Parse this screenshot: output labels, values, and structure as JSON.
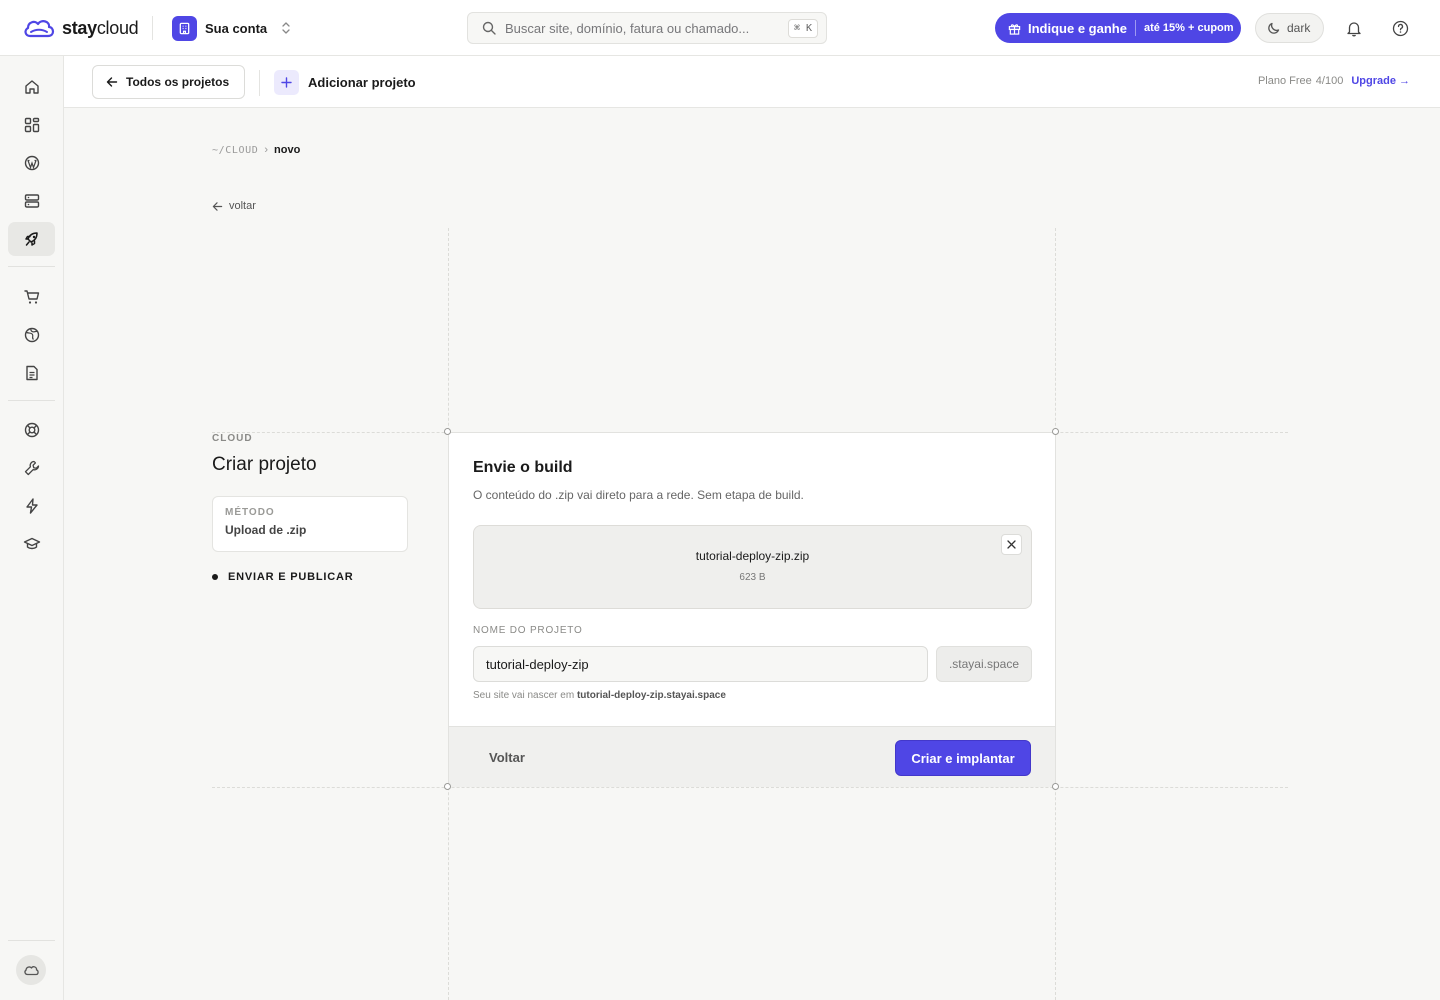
{
  "brand": {
    "bold": "stay",
    "light": "cloud"
  },
  "account": {
    "name": "Sua conta"
  },
  "search": {
    "placeholder": "Buscar site, domínio, fatura ou chamado...",
    "shortcut": "⌘ K"
  },
  "referral": {
    "label": "Indique e ganhe",
    "tag": "até 15% + cupom"
  },
  "theme": {
    "label": "dark"
  },
  "colors": {
    "accent": "#4f46e5",
    "background": "#f7f7f5",
    "surface": "#ffffff"
  },
  "sidebar": {
    "items": [
      {
        "icon": "home-icon"
      },
      {
        "icon": "grid-icon"
      },
      {
        "icon": "wordpress-icon"
      },
      {
        "icon": "server-icon"
      },
      {
        "icon": "rocket-icon",
        "active": true
      },
      {
        "icon": "cart-icon"
      },
      {
        "icon": "globe-icon"
      },
      {
        "icon": "document-icon"
      },
      {
        "icon": "lifebuoy-icon"
      },
      {
        "icon": "wrench-icon"
      },
      {
        "icon": "lightning-icon"
      },
      {
        "icon": "graduation-cap-icon"
      }
    ],
    "footer_icon": "cloud-icon"
  },
  "subheader": {
    "back_label": "Todos os projetos",
    "add_label": "Adicionar projeto",
    "plan": "Plano Free",
    "plan_usage": "4/100",
    "upgrade": "Upgrade →"
  },
  "breadcrumb": {
    "root": "~/CLOUD",
    "separator": "›",
    "current": "novo"
  },
  "back_link": "voltar",
  "wizard": {
    "eyebrow": "CLOUD",
    "title": "Criar projeto",
    "method_label": "MÉTODO",
    "method_value": "Upload de .zip",
    "step_label": "ENVIAR E PUBLICAR"
  },
  "card": {
    "title": "Envie o build",
    "subtitle": "O conteúdo do .zip vai direto para a rede. Sem etapa de build.",
    "file_name": "tutorial-deploy-zip.zip",
    "file_size": "623 B",
    "field_label": "NOME DO PROJETO",
    "project_name": "tutorial-deploy-zip",
    "suffix": ".stayai.space",
    "hint_prefix": "Seu site vai nascer em",
    "hint_domain": "tutorial-deploy-zip.stayai.space",
    "back_button": "Voltar",
    "create_button": "Criar e implantar"
  }
}
